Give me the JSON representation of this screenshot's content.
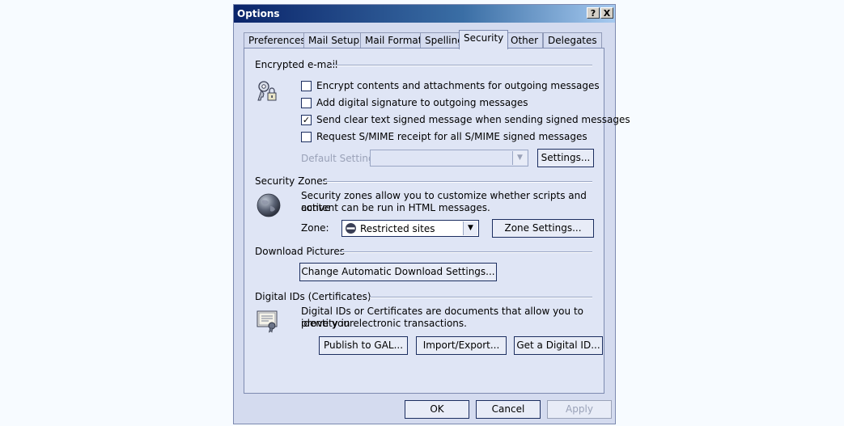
{
  "dialog": {
    "title": "Options",
    "help_btn": "?",
    "close_btn": "X"
  },
  "tabs": [
    {
      "label": "Preferences"
    },
    {
      "label": "Mail Setup"
    },
    {
      "label": "Mail Format"
    },
    {
      "label": "Spelling"
    },
    {
      "label": "Security"
    },
    {
      "label": "Other"
    },
    {
      "label": "Delegates"
    }
  ],
  "active_tab": "Security",
  "encrypted": {
    "title": "Encrypted e-mail",
    "options": [
      {
        "label": "Encrypt contents and attachments for outgoing messages",
        "checked": false
      },
      {
        "label": "Add digital signature to outgoing messages",
        "checked": false
      },
      {
        "label": "Send clear text signed message when sending signed messages",
        "checked": true
      },
      {
        "label": "Request S/MIME receipt for all S/MIME signed messages",
        "checked": false
      }
    ],
    "default_setting_label": "Default Setting:",
    "default_setting_value": "",
    "settings_button": "Settings..."
  },
  "zones": {
    "title": "Security Zones",
    "desc1": "Security zones allow you to customize whether scripts and active",
    "desc2": "content can be run in HTML messages.",
    "zone_label": "Zone:",
    "zone_value": "Restricted sites",
    "zone_settings_button": "Zone Settings..."
  },
  "download": {
    "title": "Download Pictures",
    "button": "Change Automatic Download Settings..."
  },
  "digital_ids": {
    "title": "Digital IDs (Certificates)",
    "desc1": "Digital IDs or Certificates are documents that allow you to prove your",
    "desc2": "identity in electronic transactions.",
    "publish_button": "Publish to GAL...",
    "import_button": "Import/Export...",
    "get_button": "Get a Digital ID..."
  },
  "footer": {
    "ok": "OK",
    "cancel": "Cancel",
    "apply": "Apply"
  }
}
